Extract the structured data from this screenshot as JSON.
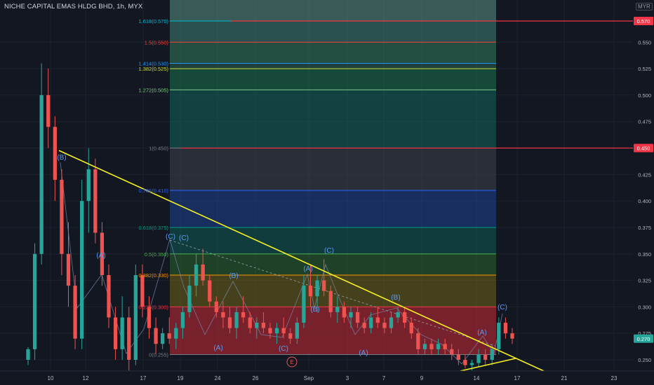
{
  "header": {
    "title": "NICHE CAPITAL EMAS HLDG BHD, 1h, MYX",
    "currency": "MYR"
  },
  "chart_data": {
    "type": "candlestick",
    "title": "NICHE CAPITAL EMAS HLDG BHD, 1h, MYX",
    "ylim": [
      0.24,
      0.585
    ],
    "x_ticks": [
      "10",
      "12",
      "17",
      "19",
      "24",
      "26",
      "Sep",
      "3",
      "7",
      "9",
      "14",
      "17",
      "21",
      "23"
    ],
    "y_ticks": [
      "0.550",
      "0.525",
      "0.500",
      "0.475",
      "0.450",
      "0.425",
      "0.400",
      "0.375",
      "0.350",
      "0.325",
      "0.300",
      "0.275",
      "0.250"
    ],
    "price_tags": [
      {
        "label": "0.570",
        "value": 0.57,
        "color": "#f23645"
      },
      {
        "label": "0.450",
        "value": 0.45,
        "color": "#f23645"
      },
      {
        "label": "0.270",
        "value": 0.27,
        "color": "#26a69a"
      }
    ],
    "fib_levels": [
      {
        "label": "0(0.255)",
        "value": 0.255,
        "color": "#787b86",
        "fill": "#000000"
      },
      {
        "label": "0.236(0.300)",
        "value": 0.3,
        "color": "#f23645",
        "fill": "#b22833"
      },
      {
        "label": "0.382(0.330)",
        "value": 0.33,
        "color": "#ff9800",
        "fill": "#8a7d16"
      },
      {
        "label": "0.5(0.350)",
        "value": 0.35,
        "color": "#4caf50",
        "fill": "#2e7d32"
      },
      {
        "label": "0.618(0.375)",
        "value": 0.375,
        "color": "#089981",
        "fill": "#0b6f63"
      },
      {
        "label": "0.786(0.410)",
        "value": 0.41,
        "color": "#2962ff",
        "fill": "#1e4fb5"
      },
      {
        "label": "1(0.450)",
        "value": 0.45,
        "color": "#787b86",
        "fill": "#4a4e5a"
      },
      {
        "label": "1.272(0.505)",
        "value": 0.505,
        "color": "#81c784",
        "fill": "#0e7c6b"
      },
      {
        "label": "1.382(0.525)",
        "value": 0.525,
        "color": "#cddc39",
        "fill": "#1b8f5b"
      },
      {
        "label": "1.414(0.530)",
        "value": 0.53,
        "color": "#2196f3",
        "fill": "#2f7d5f"
      },
      {
        "label": "1.5(0.550)",
        "value": 0.55,
        "color": "#f44336",
        "fill": "#3f9a73"
      },
      {
        "label": "1.618(0.570)",
        "value": 0.57,
        "color": "#00bcd4",
        "fill": "#4da390"
      }
    ],
    "horizontal_lines": [
      {
        "value": 0.57,
        "color": "#f23645"
      },
      {
        "value": 0.45,
        "color": "#f23645"
      }
    ],
    "trendlines": [
      {
        "from": [
          "10",
          0.448
        ],
        "to": [
          "21",
          0.24
        ],
        "color": "#f7f222"
      },
      {
        "from": [
          "14",
          0.248
        ],
        "to": [
          "17",
          0.256
        ],
        "color": "#f7f222"
      }
    ],
    "wave_labels": [
      "(B)",
      "(A)",
      "(C)",
      "(B)",
      "(A)",
      "(C)",
      "(A)",
      "(C)",
      "(B)",
      "(A)",
      "(B)",
      "(C)",
      "(A)",
      "(C)",
      "(B)",
      "E"
    ],
    "candles": [
      {
        "o": 0.25,
        "h": 0.262,
        "l": 0.245,
        "c": 0.26
      },
      {
        "o": 0.26,
        "h": 0.36,
        "l": 0.25,
        "c": 0.35
      },
      {
        "o": 0.35,
        "h": 0.53,
        "l": 0.34,
        "c": 0.5
      },
      {
        "o": 0.5,
        "h": 0.525,
        "l": 0.45,
        "c": 0.47
      },
      {
        "o": 0.47,
        "h": 0.48,
        "l": 0.4,
        "c": 0.42
      },
      {
        "o": 0.42,
        "h": 0.43,
        "l": 0.33,
        "c": 0.35
      },
      {
        "o": 0.35,
        "h": 0.38,
        "l": 0.3,
        "c": 0.32
      },
      {
        "o": 0.32,
        "h": 0.33,
        "l": 0.26,
        "c": 0.27
      },
      {
        "o": 0.27,
        "h": 0.42,
        "l": 0.26,
        "c": 0.4
      },
      {
        "o": 0.4,
        "h": 0.45,
        "l": 0.37,
        "c": 0.43
      },
      {
        "o": 0.43,
        "h": 0.44,
        "l": 0.36,
        "c": 0.37
      },
      {
        "o": 0.37,
        "h": 0.38,
        "l": 0.32,
        "c": 0.33
      },
      {
        "o": 0.33,
        "h": 0.34,
        "l": 0.28,
        "c": 0.29
      },
      {
        "o": 0.29,
        "h": 0.3,
        "l": 0.25,
        "c": 0.26
      },
      {
        "o": 0.26,
        "h": 0.31,
        "l": 0.25,
        "c": 0.29
      },
      {
        "o": 0.29,
        "h": 0.3,
        "l": 0.24,
        "c": 0.25
      },
      {
        "o": 0.25,
        "h": 0.34,
        "l": 0.245,
        "c": 0.33
      },
      {
        "o": 0.33,
        "h": 0.34,
        "l": 0.29,
        "c": 0.3
      },
      {
        "o": 0.3,
        "h": 0.31,
        "l": 0.27,
        "c": 0.28
      },
      {
        "o": 0.28,
        "h": 0.29,
        "l": 0.255,
        "c": 0.265
      },
      {
        "o": 0.265,
        "h": 0.28,
        "l": 0.26,
        "c": 0.275
      },
      {
        "o": 0.275,
        "h": 0.29,
        "l": 0.265,
        "c": 0.27
      },
      {
        "o": 0.27,
        "h": 0.285,
        "l": 0.26,
        "c": 0.28
      },
      {
        "o": 0.28,
        "h": 0.3,
        "l": 0.27,
        "c": 0.295
      },
      {
        "o": 0.295,
        "h": 0.33,
        "l": 0.29,
        "c": 0.32
      },
      {
        "o": 0.32,
        "h": 0.35,
        "l": 0.31,
        "c": 0.34
      },
      {
        "o": 0.34,
        "h": 0.355,
        "l": 0.32,
        "c": 0.325
      },
      {
        "o": 0.325,
        "h": 0.33,
        "l": 0.3,
        "c": 0.305
      },
      {
        "o": 0.305,
        "h": 0.31,
        "l": 0.29,
        "c": 0.295
      },
      {
        "o": 0.295,
        "h": 0.305,
        "l": 0.28,
        "c": 0.29
      },
      {
        "o": 0.29,
        "h": 0.3,
        "l": 0.275,
        "c": 0.28
      },
      {
        "o": 0.28,
        "h": 0.3,
        "l": 0.27,
        "c": 0.295
      },
      {
        "o": 0.295,
        "h": 0.31,
        "l": 0.285,
        "c": 0.29
      },
      {
        "o": 0.29,
        "h": 0.295,
        "l": 0.275,
        "c": 0.28
      },
      {
        "o": 0.28,
        "h": 0.29,
        "l": 0.27,
        "c": 0.285
      },
      {
        "o": 0.285,
        "h": 0.295,
        "l": 0.275,
        "c": 0.28
      },
      {
        "o": 0.28,
        "h": 0.285,
        "l": 0.27,
        "c": 0.275
      },
      {
        "o": 0.275,
        "h": 0.285,
        "l": 0.265,
        "c": 0.28
      },
      {
        "o": 0.28,
        "h": 0.29,
        "l": 0.27,
        "c": 0.275
      },
      {
        "o": 0.275,
        "h": 0.28,
        "l": 0.265,
        "c": 0.27
      },
      {
        "o": 0.27,
        "h": 0.29,
        "l": 0.265,
        "c": 0.285
      },
      {
        "o": 0.285,
        "h": 0.33,
        "l": 0.28,
        "c": 0.32
      },
      {
        "o": 0.32,
        "h": 0.34,
        "l": 0.3,
        "c": 0.31
      },
      {
        "o": 0.31,
        "h": 0.33,
        "l": 0.295,
        "c": 0.325
      },
      {
        "o": 0.325,
        "h": 0.345,
        "l": 0.31,
        "c": 0.315
      },
      {
        "o": 0.315,
        "h": 0.32,
        "l": 0.29,
        "c": 0.295
      },
      {
        "o": 0.295,
        "h": 0.31,
        "l": 0.285,
        "c": 0.3
      },
      {
        "o": 0.3,
        "h": 0.305,
        "l": 0.285,
        "c": 0.29
      },
      {
        "o": 0.29,
        "h": 0.3,
        "l": 0.28,
        "c": 0.295
      },
      {
        "o": 0.295,
        "h": 0.3,
        "l": 0.28,
        "c": 0.285
      },
      {
        "o": 0.285,
        "h": 0.29,
        "l": 0.275,
        "c": 0.28
      },
      {
        "o": 0.28,
        "h": 0.295,
        "l": 0.275,
        "c": 0.29
      },
      {
        "o": 0.29,
        "h": 0.3,
        "l": 0.28,
        "c": 0.285
      },
      {
        "o": 0.285,
        "h": 0.29,
        "l": 0.275,
        "c": 0.28
      },
      {
        "o": 0.28,
        "h": 0.295,
        "l": 0.275,
        "c": 0.29
      },
      {
        "o": 0.29,
        "h": 0.3,
        "l": 0.285,
        "c": 0.295
      },
      {
        "o": 0.295,
        "h": 0.3,
        "l": 0.28,
        "c": 0.285
      },
      {
        "o": 0.285,
        "h": 0.29,
        "l": 0.27,
        "c": 0.275
      },
      {
        "o": 0.275,
        "h": 0.28,
        "l": 0.255,
        "c": 0.26
      },
      {
        "o": 0.26,
        "h": 0.27,
        "l": 0.255,
        "c": 0.265
      },
      {
        "o": 0.265,
        "h": 0.27,
        "l": 0.255,
        "c": 0.26
      },
      {
        "o": 0.26,
        "h": 0.27,
        "l": 0.255,
        "c": 0.265
      },
      {
        "o": 0.265,
        "h": 0.27,
        "l": 0.255,
        "c": 0.26
      },
      {
        "o": 0.26,
        "h": 0.265,
        "l": 0.25,
        "c": 0.255
      },
      {
        "o": 0.255,
        "h": 0.26,
        "l": 0.245,
        "c": 0.25
      },
      {
        "o": 0.25,
        "h": 0.255,
        "l": 0.242,
        "c": 0.245
      },
      {
        "o": 0.245,
        "h": 0.25,
        "l": 0.24,
        "c": 0.247
      },
      {
        "o": 0.247,
        "h": 0.26,
        "l": 0.243,
        "c": 0.255
      },
      {
        "o": 0.255,
        "h": 0.26,
        "l": 0.245,
        "c": 0.25
      },
      {
        "o": 0.25,
        "h": 0.265,
        "l": 0.245,
        "c": 0.26
      },
      {
        "o": 0.26,
        "h": 0.29,
        "l": 0.255,
        "c": 0.285
      },
      {
        "o": 0.285,
        "h": 0.29,
        "l": 0.27,
        "c": 0.275
      },
      {
        "o": 0.275,
        "h": 0.28,
        "l": 0.265,
        "c": 0.27
      }
    ]
  }
}
